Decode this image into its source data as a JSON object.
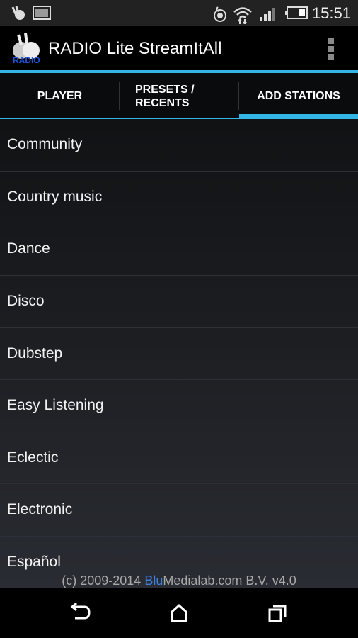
{
  "status_bar": {
    "time": "15:51",
    "icons": [
      "app-notification-icon",
      "image-notification-icon",
      "hotspot-icon",
      "wifi-icon",
      "signal-icon",
      "battery-icon"
    ]
  },
  "app_bar": {
    "title": "RADIO Lite StreamItAll",
    "logo_text": "RADIO"
  },
  "tabs": [
    {
      "label": "PLAYER",
      "active": false
    },
    {
      "label": "PRESETS / RECENTS",
      "line1": "PRESETS /",
      "line2": "RECENTS",
      "active": false
    },
    {
      "label": "ADD STATIONS",
      "active": true
    }
  ],
  "genres": [
    "Community",
    "Country music",
    "Dance",
    "Disco",
    "Dubstep",
    "Easy Listening",
    "Eclectic",
    "Electronic",
    "Español"
  ],
  "footer": {
    "prefix": "(c) 2009-2014 ",
    "brand_highlight": "Blu",
    "brand_rest": "Medialab.com B.V. v4.0"
  },
  "colors": {
    "accent": "#33b5e5",
    "brand": "#3f7fe0"
  }
}
